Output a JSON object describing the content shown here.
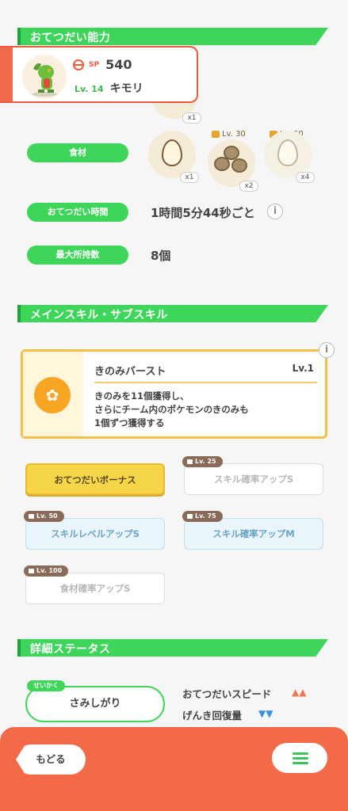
{
  "sections": {
    "help_ability": "おてつだい能力",
    "skills": "メインスキル・サブスキル",
    "details": "詳細ステータス"
  },
  "pokemon": {
    "sp_label": "SP",
    "sp_value": "540",
    "level": "Lv. 14",
    "name": "キモリ"
  },
  "rows": {
    "ingredients_label": "食材",
    "help_time_label": "おてつだい時間",
    "help_time_value": "1時間5分44秒ごと",
    "max_carry_label": "最大所持数",
    "max_carry_value": "8個"
  },
  "ingredients": [
    {
      "name": "egg",
      "count": "x1",
      "lock": ""
    },
    {
      "name": "walnut",
      "count": "x2",
      "lock": "Lv. 30"
    },
    {
      "name": "egg",
      "count": "x4",
      "lock": "Lv. 60"
    }
  ],
  "top_partial_count": "x1",
  "main_skill": {
    "title": "きのみバースト",
    "level": "Lv.1",
    "description": "きのみを11個獲得し、\nさらにチーム内のポケモンのきのみも\n1個ずつ獲得する"
  },
  "sub_skills": [
    {
      "label": "おてつだいボーナス",
      "lock": ""
    },
    {
      "label": "スキル確率アップS",
      "lock": "Lv. 25"
    },
    {
      "label": "スキルレベルアップS",
      "lock": "Lv. 50"
    },
    {
      "label": "スキル確率アップM",
      "lock": "Lv. 75"
    },
    {
      "label": "食材確率アップS",
      "lock": "Lv. 100"
    }
  ],
  "nature": {
    "tag": "せいかく",
    "value": "さみしがり",
    "up_stat": "おてつだいスピード",
    "down_stat": "げんき回復量",
    "up_arrows": "▲▲",
    "down_arrows": "▼▼",
    "up_color": "#f2784b",
    "down_color": "#3a8ee6"
  },
  "footer": {
    "back_label": "もどる"
  },
  "colors": {
    "accent_green": "#3ed65a",
    "accent_orange": "#f26a48",
    "skill_gold": "#f3c14a"
  }
}
